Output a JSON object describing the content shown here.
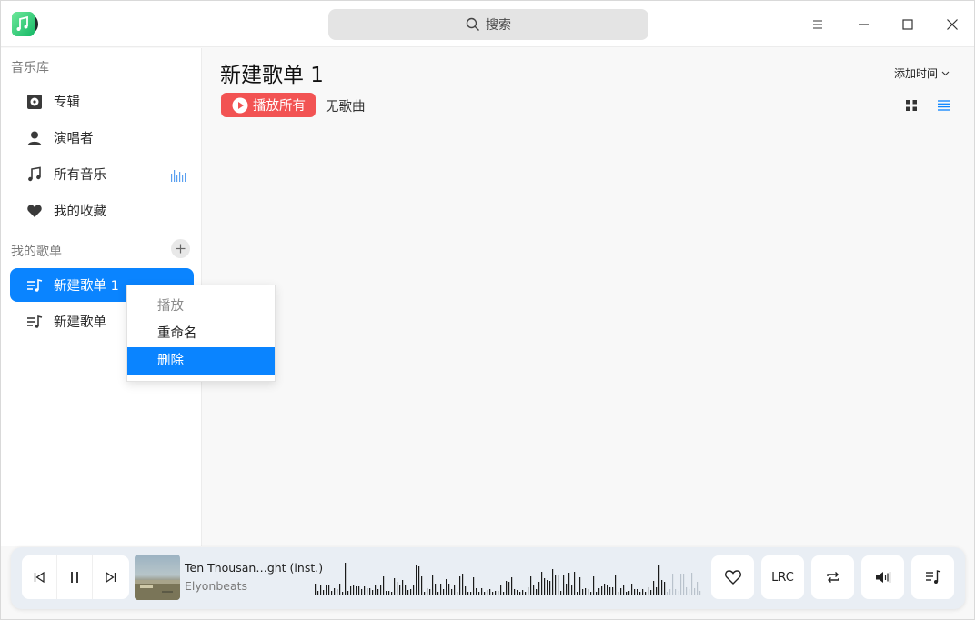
{
  "titlebar": {
    "search_placeholder": "搜索",
    "icons": [
      "music-app-icon",
      "search-icon",
      "menu-icon",
      "minimize-icon",
      "maximize-icon",
      "close-icon"
    ]
  },
  "sidebar": {
    "library_label": "音乐库",
    "library_items": [
      {
        "label": "专辑",
        "icon": "album-icon"
      },
      {
        "label": "演唱者",
        "icon": "singer-icon"
      },
      {
        "label": "所有音乐",
        "icon": "music-note-icon"
      },
      {
        "label": "我的收藏",
        "icon": "heart-icon"
      }
    ],
    "playlists_label": "我的歌单",
    "playlists": [
      {
        "label": "新建歌单 1",
        "active": true
      },
      {
        "label": "新建歌单",
        "active": false
      }
    ]
  },
  "context_menu": {
    "items": [
      {
        "label": "播放",
        "state": "disabled"
      },
      {
        "label": "重命名",
        "state": "normal"
      },
      {
        "label": "删除",
        "state": "highlighted"
      }
    ]
  },
  "main": {
    "title": "新建歌单 1",
    "play_all": "播放所有",
    "song_count": "无歌曲",
    "sort_label": "添加时间"
  },
  "player": {
    "song_title": "Ten Thousan…ght (inst.)",
    "artist": "Elyonbeats",
    "lyrics_label": "LRC",
    "progress_fraction": 0.91
  },
  "colors": {
    "accent": "#0a84ff",
    "play_all": "#f25353"
  }
}
